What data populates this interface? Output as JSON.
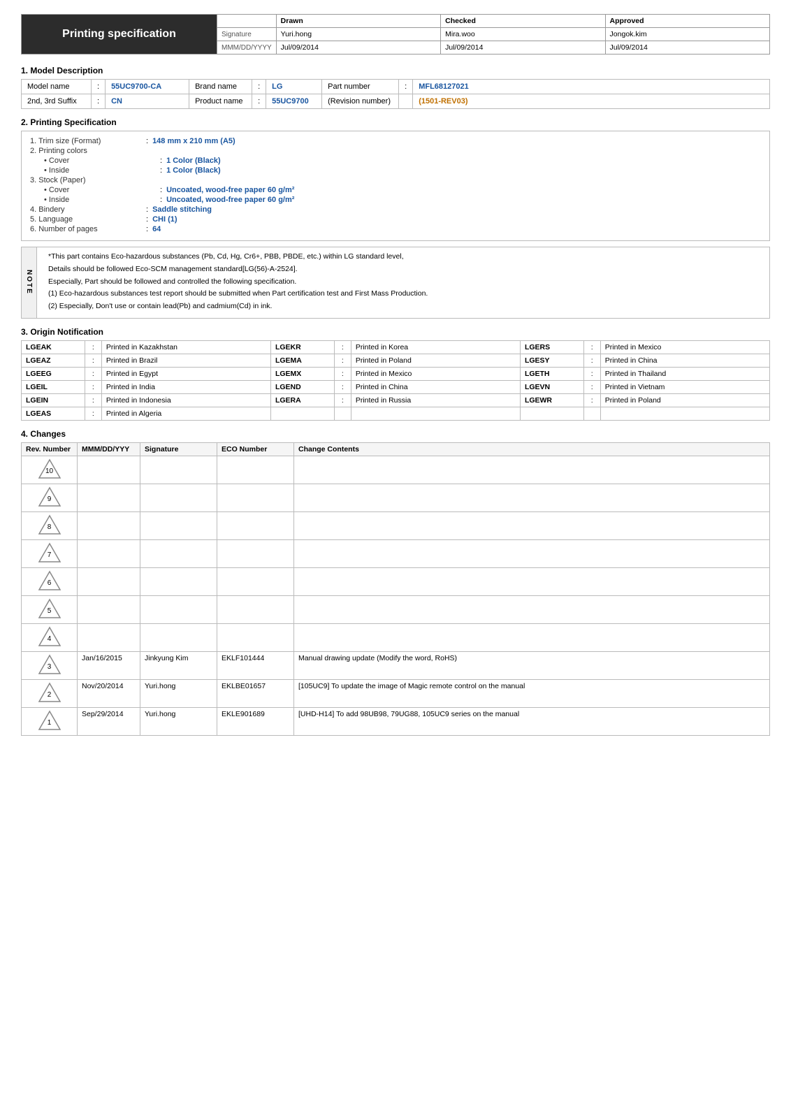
{
  "header": {
    "title": "Printing specification",
    "cols": [
      "",
      "Drawn",
      "Checked",
      "Approved"
    ],
    "rows": [
      {
        "label": "Signature",
        "drawn": "Yuri.hong",
        "checked": "Mira.woo",
        "approved": "Jongok.kim"
      },
      {
        "label": "MMM/DD/YYYY",
        "drawn": "Jul/09/2014",
        "checked": "Jul/09/2014",
        "approved": "Jul/09/2014"
      }
    ]
  },
  "sections": {
    "model": {
      "title": "1. Model Description",
      "rows": [
        {
          "label": "Model name",
          "colon": ":",
          "value1": "55UC9700-CA",
          "label2": "Brand name",
          "colon2": ":",
          "value2": "LG",
          "label3": "Part number",
          "colon3": ":",
          "value3": "MFL68127021"
        },
        {
          "label": "2nd, 3rd Suffix",
          "colon": ":",
          "value1": "CN",
          "label2": "Product name",
          "colon2": ":",
          "value2": "55UC9700",
          "label3": "(Revision number)",
          "colon3": "",
          "value3": "(1501-REV03)"
        }
      ]
    },
    "printing": {
      "title": "2. Printing Specification",
      "items": [
        {
          "number": "1.",
          "label": "Trim size (Format)",
          "colon": ":",
          "value": "148 mm x 210 mm (A5)",
          "indent": 0
        },
        {
          "number": "2.",
          "label": "Printing colors",
          "colon": "",
          "value": "",
          "indent": 0
        },
        {
          "number": "",
          "label": "• Cover",
          "colon": ":",
          "value": "1 Color (Black)",
          "indent": 1
        },
        {
          "number": "",
          "label": "• Inside",
          "colon": ":",
          "value": "1 Color (Black)",
          "indent": 1
        },
        {
          "number": "3.",
          "label": "Stock (Paper)",
          "colon": "",
          "value": "",
          "indent": 0
        },
        {
          "number": "",
          "label": "• Cover",
          "colon": ":",
          "value": "Uncoated, wood-free paper 60 g/m²",
          "indent": 1
        },
        {
          "number": "",
          "label": "• Inside",
          "colon": ":",
          "value": "Uncoated, wood-free paper 60 g/m²",
          "indent": 1
        },
        {
          "number": "4.",
          "label": "Bindery",
          "colon": ":",
          "value": "Saddle stitching",
          "indent": 0
        },
        {
          "number": "5.",
          "label": "Language",
          "colon": ":",
          "value": "CHI (1)",
          "indent": 0
        },
        {
          "number": "6.",
          "label": "Number of pages",
          "colon": ":",
          "value": "64",
          "indent": 0
        }
      ]
    },
    "note": {
      "side": "NOTE",
      "lines": [
        "*This part contains Eco-hazardous substances (Pb, Cd, Hg, Cr6+, PBB, PBDE, etc.) within LG standard level,",
        "Details should be followed Eco-SCM management standard[LG(56)-A-2524].",
        "Especially, Part should be followed and controlled the following specification.",
        "(1) Eco-hazardous substances test report should be submitted when Part certification test and First Mass Production.",
        "(2) Especially, Don't use or contain lead(Pb) and cadmium(Cd) in ink."
      ]
    },
    "origin": {
      "title": "3. Origin Notification",
      "rows": [
        [
          {
            "code": "LGEAK",
            "desc": "Printed in Kazakhstan"
          },
          {
            "code": "LGEKR",
            "desc": "Printed in Korea"
          },
          {
            "code": "LGERS",
            "desc": "Printed in Mexico"
          }
        ],
        [
          {
            "code": "LGEAZ",
            "desc": "Printed in Brazil"
          },
          {
            "code": "LGEMA",
            "desc": "Printed in Poland"
          },
          {
            "code": "LGESY",
            "desc": "Printed in China"
          }
        ],
        [
          {
            "code": "LGEEG",
            "desc": "Printed in Egypt"
          },
          {
            "code": "LGEMX",
            "desc": "Printed in Mexico"
          },
          {
            "code": "LGETH",
            "desc": "Printed in Thailand"
          }
        ],
        [
          {
            "code": "LGEIL",
            "desc": "Printed in India"
          },
          {
            "code": "LGEND",
            "desc": "Printed in China"
          },
          {
            "code": "LGEVN",
            "desc": "Printed in Vietnam"
          }
        ],
        [
          {
            "code": "LGEIN",
            "desc": "Printed in Indonesia"
          },
          {
            "code": "LGERA",
            "desc": "Printed in Russia"
          },
          {
            "code": "LGEWR",
            "desc": "Printed in Poland"
          }
        ],
        [
          {
            "code": "LGEAS",
            "desc": "Printed in Algeria"
          },
          {
            "code": "",
            "desc": ""
          },
          {
            "code": "",
            "desc": ""
          }
        ]
      ]
    },
    "changes": {
      "title": "4. Changes",
      "header": [
        "Rev. Number",
        "MMM/DD/YYY",
        "Signature",
        "ECO Number",
        "Change Contents"
      ],
      "rows": [
        {
          "rev": "10",
          "date": "",
          "sig": "",
          "eco": "",
          "desc": ""
        },
        {
          "rev": "9",
          "date": "",
          "sig": "",
          "eco": "",
          "desc": ""
        },
        {
          "rev": "8",
          "date": "",
          "sig": "",
          "eco": "",
          "desc": ""
        },
        {
          "rev": "7",
          "date": "",
          "sig": "",
          "eco": "",
          "desc": ""
        },
        {
          "rev": "6",
          "date": "",
          "sig": "",
          "eco": "",
          "desc": ""
        },
        {
          "rev": "5",
          "date": "",
          "sig": "",
          "eco": "",
          "desc": ""
        },
        {
          "rev": "4",
          "date": "",
          "sig": "",
          "eco": "",
          "desc": ""
        },
        {
          "rev": "3",
          "date": "Jan/16/2015",
          "sig": "Jinkyung Kim",
          "eco": "EKLF101444",
          "desc": "Manual drawing update (Modify the word, RoHS)"
        },
        {
          "rev": "2",
          "date": "Nov/20/2014",
          "sig": "Yuri.hong",
          "eco": "EKLBE01657",
          "desc": "[105UC9] To update the image of Magic remote control on the manual"
        },
        {
          "rev": "1",
          "date": "Sep/29/2014",
          "sig": "Yuri.hong",
          "eco": "EKLE901689",
          "desc": "[UHD-H14] To add 98UB98, 79UG88, 105UC9 series on the manual"
        }
      ]
    }
  }
}
